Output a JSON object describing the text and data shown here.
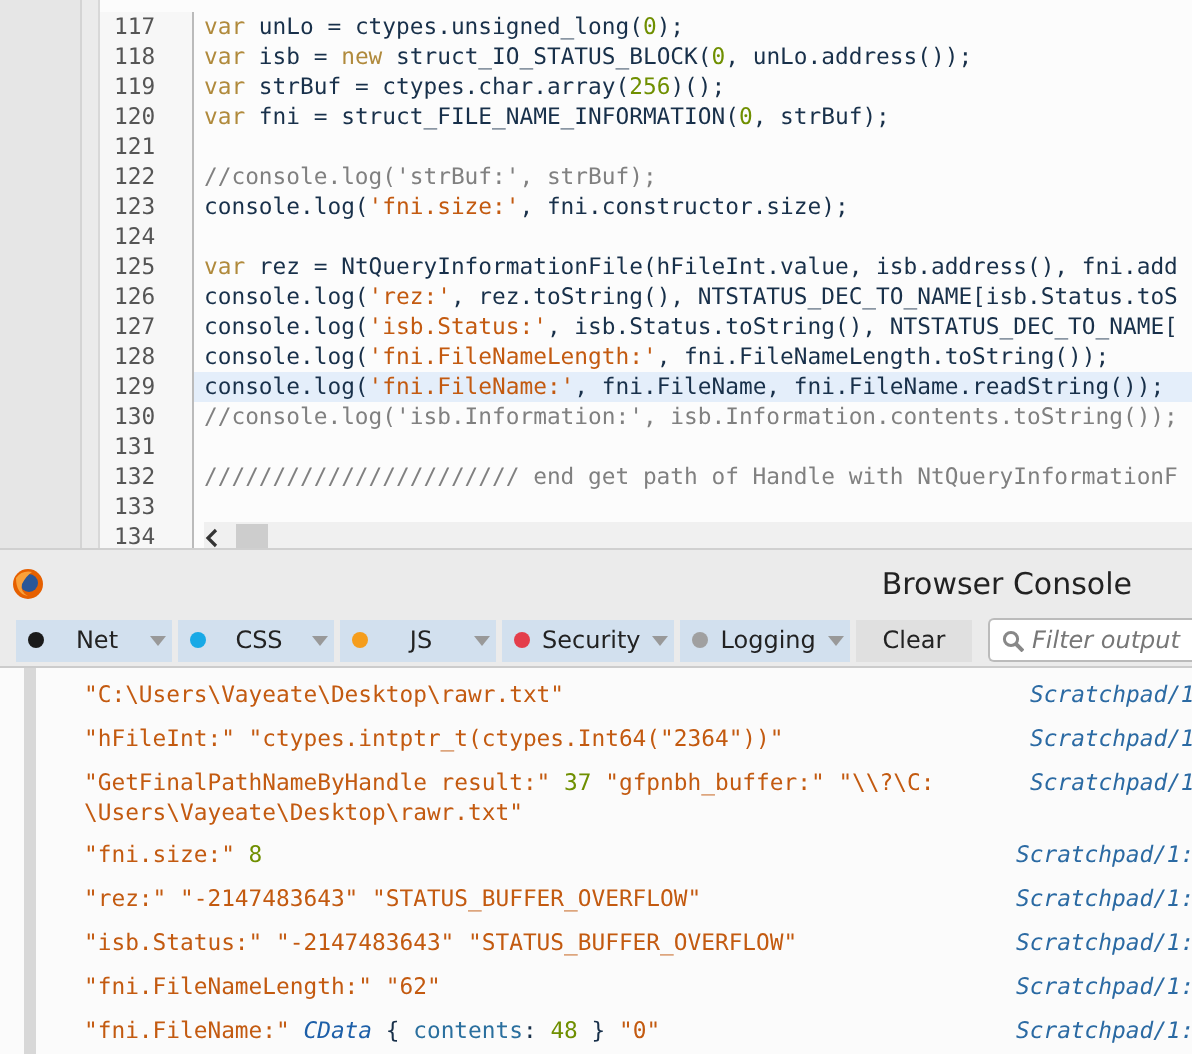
{
  "editor": {
    "lines": [
      {
        "number": "117",
        "current": false,
        "segments": [
          {
            "kind": "keyword",
            "text": "var"
          },
          {
            "kind": "plain",
            "text": " unLo = ctypes.unsigned_long("
          },
          {
            "kind": "number",
            "text": "0"
          },
          {
            "kind": "plain",
            "text": ");"
          }
        ]
      },
      {
        "number": "118",
        "current": false,
        "segments": [
          {
            "kind": "keyword",
            "text": "var"
          },
          {
            "kind": "plain",
            "text": " isb = "
          },
          {
            "kind": "keyword",
            "text": "new"
          },
          {
            "kind": "plain",
            "text": " struct_IO_STATUS_BLOCK("
          },
          {
            "kind": "number",
            "text": "0"
          },
          {
            "kind": "plain",
            "text": ", unLo.address());"
          }
        ]
      },
      {
        "number": "119",
        "current": false,
        "segments": [
          {
            "kind": "keyword",
            "text": "var"
          },
          {
            "kind": "plain",
            "text": " strBuf = ctypes.char.array("
          },
          {
            "kind": "number",
            "text": "256"
          },
          {
            "kind": "plain",
            "text": ")();"
          }
        ]
      },
      {
        "number": "120",
        "current": false,
        "segments": [
          {
            "kind": "keyword",
            "text": "var"
          },
          {
            "kind": "plain",
            "text": " fni = struct_FILE_NAME_INFORMATION("
          },
          {
            "kind": "number",
            "text": "0"
          },
          {
            "kind": "plain",
            "text": ", strBuf);"
          }
        ]
      },
      {
        "number": "121",
        "current": false
      },
      {
        "number": "122",
        "current": false,
        "segments": [
          {
            "kind": "comment",
            "text": "//console.log('strBuf:', strBuf);"
          }
        ]
      },
      {
        "number": "123",
        "current": false,
        "segments": [
          {
            "kind": "plain",
            "text": "console.log("
          },
          {
            "kind": "string",
            "text": "'fni.size:'"
          },
          {
            "kind": "plain",
            "text": ", fni.constructor.size);"
          }
        ]
      },
      {
        "number": "124",
        "current": false
      },
      {
        "number": "125",
        "current": false,
        "segments": [
          {
            "kind": "keyword",
            "text": "var"
          },
          {
            "kind": "plain",
            "text": " rez = NtQueryInformationFile(hFileInt.value, isb.address(), fni.add"
          }
        ]
      },
      {
        "number": "126",
        "current": false,
        "segments": [
          {
            "kind": "plain",
            "text": "console.log("
          },
          {
            "kind": "string",
            "text": "'rez:'"
          },
          {
            "kind": "plain",
            "text": ", rez.toString(), NTSTATUS_DEC_TO_NAME[isb.Status.toS"
          }
        ]
      },
      {
        "number": "127",
        "current": false,
        "segments": [
          {
            "kind": "plain",
            "text": "console.log("
          },
          {
            "kind": "string",
            "text": "'isb.Status:'"
          },
          {
            "kind": "plain",
            "text": ", isb.Status.toString(), NTSTATUS_DEC_TO_NAME["
          }
        ]
      },
      {
        "number": "128",
        "current": false,
        "segments": [
          {
            "kind": "plain",
            "text": "console.log("
          },
          {
            "kind": "string",
            "text": "'fni.FileNameLength:'"
          },
          {
            "kind": "plain",
            "text": ", fni.FileNameLength.toString());"
          }
        ]
      },
      {
        "number": "129",
        "current": true,
        "segments": [
          {
            "kind": "plain",
            "text": "console.log("
          },
          {
            "kind": "string",
            "text": "'fni.FileName:'"
          },
          {
            "kind": "plain",
            "text": ", fni.FileName, fni.FileName.readString());"
          }
        ]
      },
      {
        "number": "130",
        "current": false,
        "segments": [
          {
            "kind": "comment",
            "text": "//console.log('isb.Information:', isb.Information.contents.toString());"
          }
        ]
      },
      {
        "number": "131",
        "current": false
      },
      {
        "number": "132",
        "current": false,
        "segments": [
          {
            "kind": "comment",
            "text": "/////////////////////// end get path of Handle with NtQueryInformationF"
          }
        ]
      },
      {
        "number": "133",
        "current": false
      },
      {
        "number": "134",
        "current": false
      }
    ]
  },
  "console": {
    "title": "Browser Console",
    "filters": [
      {
        "label": "Net",
        "color": "#1a1a1a",
        "on": true
      },
      {
        "label": "CSS",
        "color": "#18a9e6",
        "on": true
      },
      {
        "label": "JS",
        "color": "#f59d1c",
        "on": true
      },
      {
        "label": "Security",
        "color": "#e43e4b",
        "on": true
      },
      {
        "label": "Logging",
        "color": "#a0a0a0",
        "on": true
      }
    ],
    "clear": {
      "label": "Clear"
    },
    "search": {
      "placeholder": "Filter output"
    },
    "messages": [
      {
        "source": "Scratchpad/1",
        "lines": [
          [
            {
              "kind": "string",
              "text": "\"C:\\Users\\Vayeate\\Desktop\\rawr.txt\""
            }
          ]
        ]
      },
      {
        "source": "Scratchpad/1",
        "lines": [
          [
            {
              "kind": "string",
              "text": "\"hFileInt:\" \"ctypes.intptr_t(ctypes.Int64(\"2364\"))\""
            }
          ]
        ]
      },
      {
        "source": "Scratchpad/1",
        "lines": [
          [
            {
              "kind": "string",
              "text": "\"GetFinalPathNameByHandle result:\" "
            },
            {
              "kind": "number",
              "text": "37"
            },
            {
              "kind": "string",
              "text": " \"gfpnbh_buffer:\" \"\\\\?\\C:"
            }
          ],
          [
            {
              "kind": "string",
              "text": "\\Users\\Vayeate\\Desktop\\rawr.txt\""
            }
          ]
        ]
      },
      {
        "source": "Scratchpad/1:",
        "lines": [
          [
            {
              "kind": "string",
              "text": "\"fni.size:\" "
            },
            {
              "kind": "number",
              "text": "8"
            }
          ]
        ]
      },
      {
        "source": "Scratchpad/1:",
        "lines": [
          [
            {
              "kind": "string",
              "text": "\"rez:\" \"-2147483643\" \"STATUS_BUFFER_OVERFLOW\""
            }
          ]
        ]
      },
      {
        "source": "Scratchpad/1:",
        "lines": [
          [
            {
              "kind": "string",
              "text": "\"isb.Status:\" \"-2147483643\" \"STATUS_BUFFER_OVERFLOW\""
            }
          ]
        ]
      },
      {
        "source": "Scratchpad/1:",
        "lines": [
          [
            {
              "kind": "string",
              "text": "\"fni.FileNameLength:\" \"62\""
            }
          ]
        ]
      },
      {
        "source": "Scratchpad/1:",
        "lines": [
          [
            {
              "kind": "string",
              "text": "\"fni.FileName:\" "
            },
            {
              "kind": "object",
              "text": "CData"
            },
            {
              "kind": "plain",
              "text": " { "
            },
            {
              "kind": "property",
              "text": "contents"
            },
            {
              "kind": "plain",
              "text": ": "
            },
            {
              "kind": "number",
              "text": "48"
            },
            {
              "kind": "plain",
              "text": " } "
            },
            {
              "kind": "string",
              "text": "\"0\""
            }
          ]
        ]
      }
    ]
  }
}
